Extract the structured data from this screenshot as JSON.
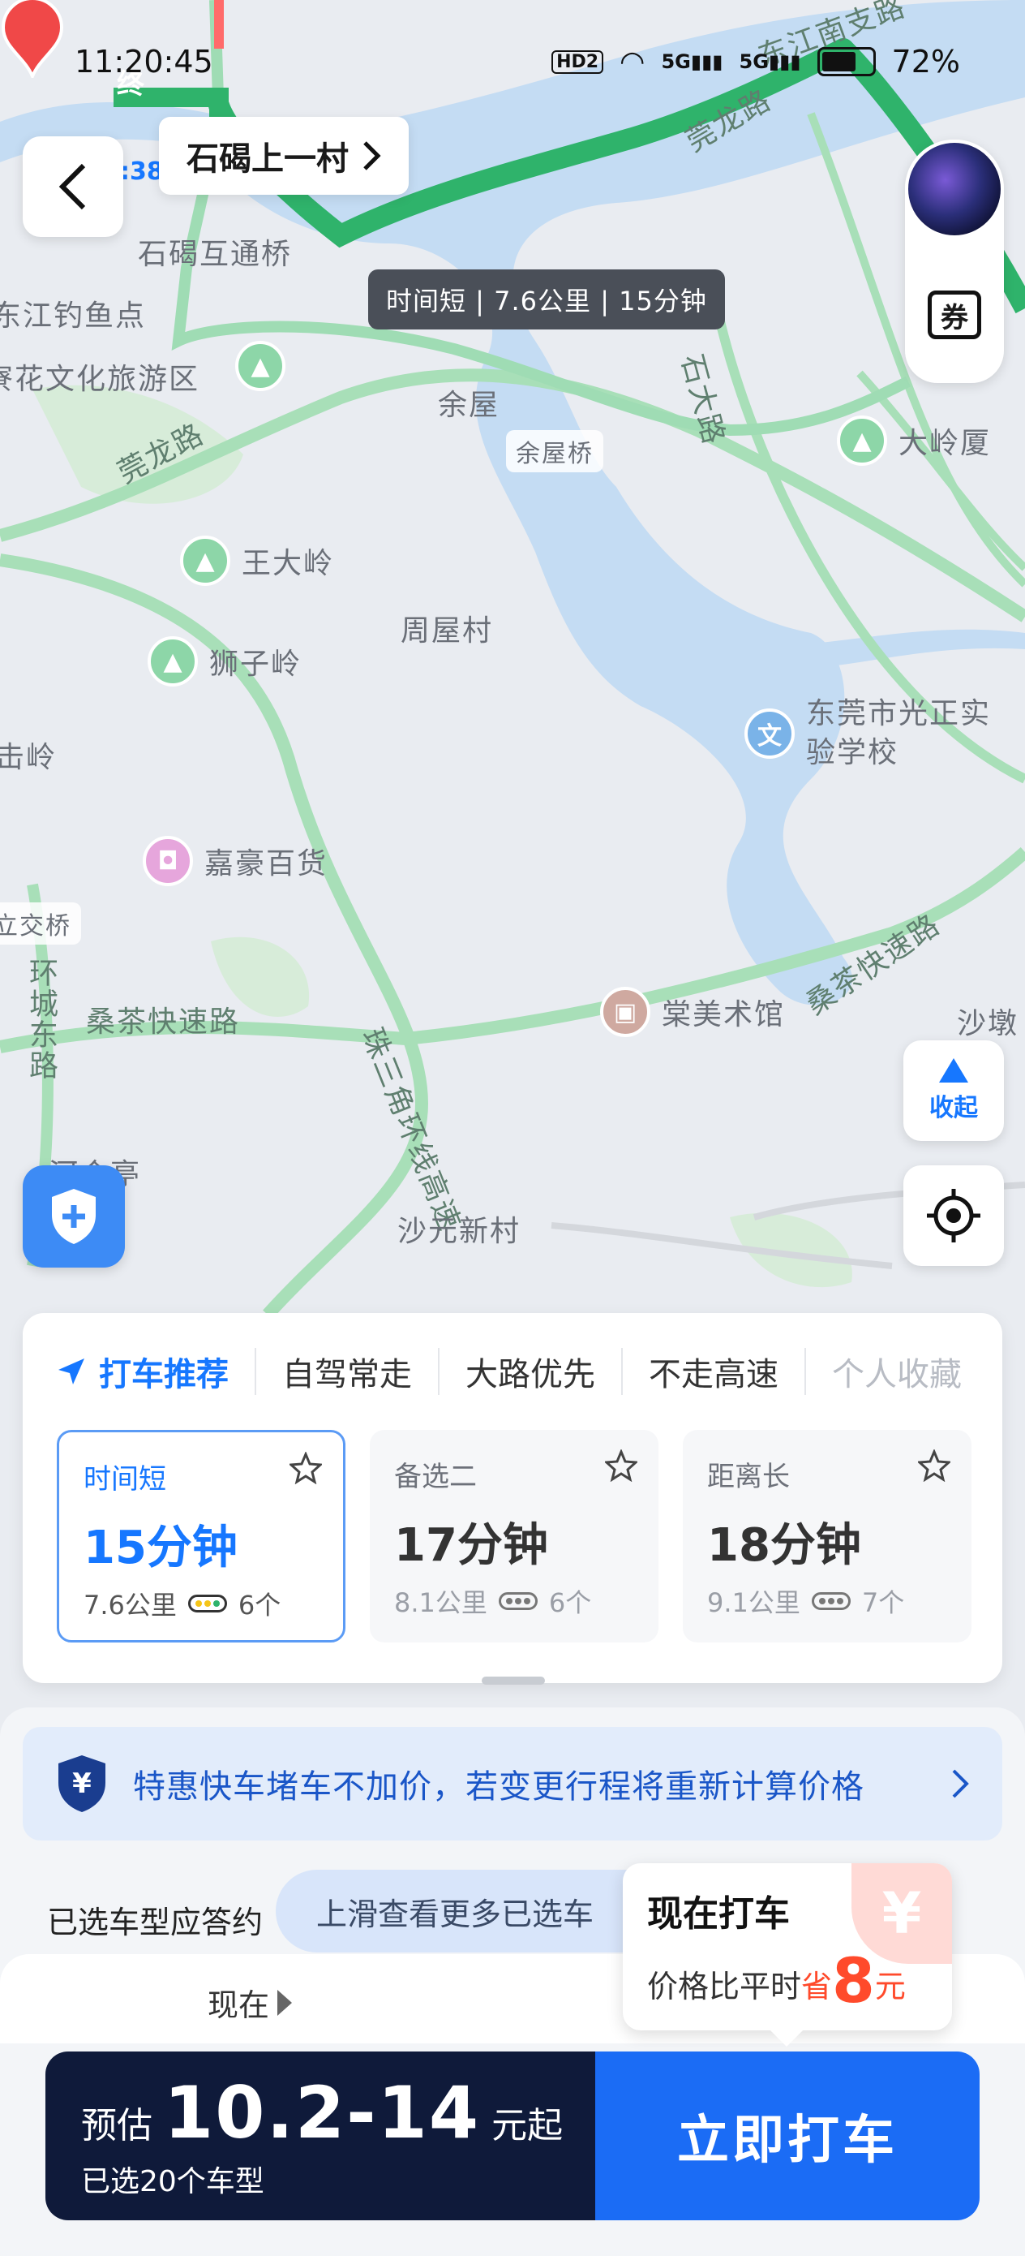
{
  "status_bar": {
    "time": "11:20:45",
    "network_badge": "HD2",
    "net1": "5G",
    "net2": "5G",
    "battery_pct": "72%",
    "battery_level": 0.72
  },
  "map": {
    "end_pin_label": "终",
    "route_time_mini": ":38",
    "destination": "石碣上一村",
    "route_bubble": "时间短 | 7.6公里 | 15分钟",
    "labels": {
      "shijie_bridge": "石碣互通桥",
      "fishing": "东江钓鱼点",
      "tourism": "寮花文化旅游区",
      "guanlong_road_1": "莞龙路",
      "guanlong_road_2": "莞龙路",
      "dongjiang_road": "东江南支路",
      "yuwu": "余屋",
      "yuwu_bridge": "余屋桥",
      "shida_road": "石大路",
      "zhouwu": "周屋村",
      "guangzheng_school": "东莞市光正实验学校",
      "wangdaling": "王大岭",
      "shiziling": "狮子岭",
      "dalingxia": "大岭厦",
      "jiahao": "嘉豪百货",
      "shangmei": "棠美术馆",
      "sangcha_road_1": "桑茶快速路",
      "sangcha_road_2": "桑茶快速路",
      "huancheng_road": "环城东路",
      "zhusanjiao": "珠三角环线高速",
      "shayuan": "沙元新村",
      "shadun": "沙墩",
      "ling_left": "击岭",
      "jiaoqiao_left": "立交桥",
      "heheting": "河合亭"
    },
    "coupon_label": "券",
    "fold_label": "收起"
  },
  "route_panel": {
    "tabs": [
      "打车推荐",
      "自驾常走",
      "大路优先",
      "不走高速",
      "个人收藏"
    ],
    "cards": [
      {
        "title": "时间短",
        "time": "15分钟",
        "distance": "7.6公里",
        "lights": "6个",
        "selected": true
      },
      {
        "title": "备选二",
        "time": "17分钟",
        "distance": "8.1公里",
        "lights": "6个",
        "selected": false
      },
      {
        "title": "距离长",
        "time": "18分钟",
        "distance": "9.1公里",
        "lights": "7个",
        "selected": false
      }
    ]
  },
  "sheet": {
    "promo": "特惠快车堵车不加价，若变更行程将重新计算价格",
    "response_text": "已选车型应答约",
    "scroll_hint": "上滑查看更多已选车",
    "now_label": "现在",
    "tip_title": "现在打车",
    "tip_desc": "价格比平时",
    "tip_save": "省",
    "tip_amount": "8",
    "tip_unit": "元",
    "tip_yen": "¥",
    "estimate_prefix": "预估",
    "estimate_price": "10.2-14",
    "estimate_suffix": "元起",
    "selected_models": "已选20个车型",
    "call_button": "立即打车"
  },
  "colors": {
    "accent": "#1677ff",
    "route_green": "#2fb36b",
    "footer_dark": "#0f1a3a",
    "save_red": "#ff4a2b"
  }
}
